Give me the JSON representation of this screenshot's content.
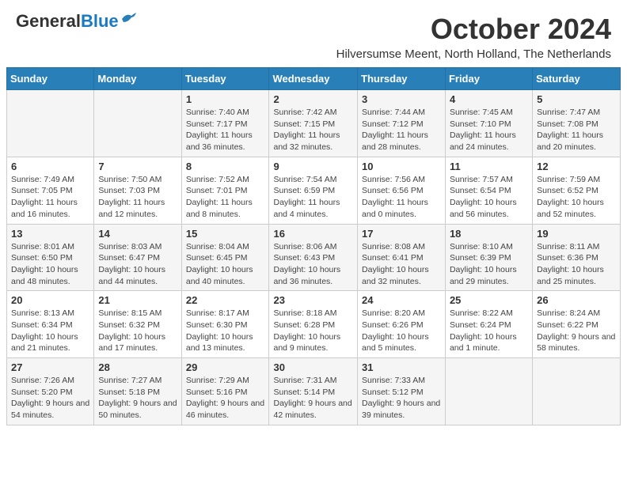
{
  "header": {
    "logo_general": "General",
    "logo_blue": "Blue",
    "month": "October 2024",
    "location": "Hilversumse Meent, North Holland, The Netherlands"
  },
  "days_of_week": [
    "Sunday",
    "Monday",
    "Tuesday",
    "Wednesday",
    "Thursday",
    "Friday",
    "Saturday"
  ],
  "weeks": [
    [
      {
        "day": "",
        "info": ""
      },
      {
        "day": "",
        "info": ""
      },
      {
        "day": "1",
        "info": "Sunrise: 7:40 AM\nSunset: 7:17 PM\nDaylight: 11 hours and 36 minutes."
      },
      {
        "day": "2",
        "info": "Sunrise: 7:42 AM\nSunset: 7:15 PM\nDaylight: 11 hours and 32 minutes."
      },
      {
        "day": "3",
        "info": "Sunrise: 7:44 AM\nSunset: 7:12 PM\nDaylight: 11 hours and 28 minutes."
      },
      {
        "day": "4",
        "info": "Sunrise: 7:45 AM\nSunset: 7:10 PM\nDaylight: 11 hours and 24 minutes."
      },
      {
        "day": "5",
        "info": "Sunrise: 7:47 AM\nSunset: 7:08 PM\nDaylight: 11 hours and 20 minutes."
      }
    ],
    [
      {
        "day": "6",
        "info": "Sunrise: 7:49 AM\nSunset: 7:05 PM\nDaylight: 11 hours and 16 minutes."
      },
      {
        "day": "7",
        "info": "Sunrise: 7:50 AM\nSunset: 7:03 PM\nDaylight: 11 hours and 12 minutes."
      },
      {
        "day": "8",
        "info": "Sunrise: 7:52 AM\nSunset: 7:01 PM\nDaylight: 11 hours and 8 minutes."
      },
      {
        "day": "9",
        "info": "Sunrise: 7:54 AM\nSunset: 6:59 PM\nDaylight: 11 hours and 4 minutes."
      },
      {
        "day": "10",
        "info": "Sunrise: 7:56 AM\nSunset: 6:56 PM\nDaylight: 11 hours and 0 minutes."
      },
      {
        "day": "11",
        "info": "Sunrise: 7:57 AM\nSunset: 6:54 PM\nDaylight: 10 hours and 56 minutes."
      },
      {
        "day": "12",
        "info": "Sunrise: 7:59 AM\nSunset: 6:52 PM\nDaylight: 10 hours and 52 minutes."
      }
    ],
    [
      {
        "day": "13",
        "info": "Sunrise: 8:01 AM\nSunset: 6:50 PM\nDaylight: 10 hours and 48 minutes."
      },
      {
        "day": "14",
        "info": "Sunrise: 8:03 AM\nSunset: 6:47 PM\nDaylight: 10 hours and 44 minutes."
      },
      {
        "day": "15",
        "info": "Sunrise: 8:04 AM\nSunset: 6:45 PM\nDaylight: 10 hours and 40 minutes."
      },
      {
        "day": "16",
        "info": "Sunrise: 8:06 AM\nSunset: 6:43 PM\nDaylight: 10 hours and 36 minutes."
      },
      {
        "day": "17",
        "info": "Sunrise: 8:08 AM\nSunset: 6:41 PM\nDaylight: 10 hours and 32 minutes."
      },
      {
        "day": "18",
        "info": "Sunrise: 8:10 AM\nSunset: 6:39 PM\nDaylight: 10 hours and 29 minutes."
      },
      {
        "day": "19",
        "info": "Sunrise: 8:11 AM\nSunset: 6:36 PM\nDaylight: 10 hours and 25 minutes."
      }
    ],
    [
      {
        "day": "20",
        "info": "Sunrise: 8:13 AM\nSunset: 6:34 PM\nDaylight: 10 hours and 21 minutes."
      },
      {
        "day": "21",
        "info": "Sunrise: 8:15 AM\nSunset: 6:32 PM\nDaylight: 10 hours and 17 minutes."
      },
      {
        "day": "22",
        "info": "Sunrise: 8:17 AM\nSunset: 6:30 PM\nDaylight: 10 hours and 13 minutes."
      },
      {
        "day": "23",
        "info": "Sunrise: 8:18 AM\nSunset: 6:28 PM\nDaylight: 10 hours and 9 minutes."
      },
      {
        "day": "24",
        "info": "Sunrise: 8:20 AM\nSunset: 6:26 PM\nDaylight: 10 hours and 5 minutes."
      },
      {
        "day": "25",
        "info": "Sunrise: 8:22 AM\nSunset: 6:24 PM\nDaylight: 10 hours and 1 minute."
      },
      {
        "day": "26",
        "info": "Sunrise: 8:24 AM\nSunset: 6:22 PM\nDaylight: 9 hours and 58 minutes."
      }
    ],
    [
      {
        "day": "27",
        "info": "Sunrise: 7:26 AM\nSunset: 5:20 PM\nDaylight: 9 hours and 54 minutes."
      },
      {
        "day": "28",
        "info": "Sunrise: 7:27 AM\nSunset: 5:18 PM\nDaylight: 9 hours and 50 minutes."
      },
      {
        "day": "29",
        "info": "Sunrise: 7:29 AM\nSunset: 5:16 PM\nDaylight: 9 hours and 46 minutes."
      },
      {
        "day": "30",
        "info": "Sunrise: 7:31 AM\nSunset: 5:14 PM\nDaylight: 9 hours and 42 minutes."
      },
      {
        "day": "31",
        "info": "Sunrise: 7:33 AM\nSunset: 5:12 PM\nDaylight: 9 hours and 39 minutes."
      },
      {
        "day": "",
        "info": ""
      },
      {
        "day": "",
        "info": ""
      }
    ]
  ]
}
